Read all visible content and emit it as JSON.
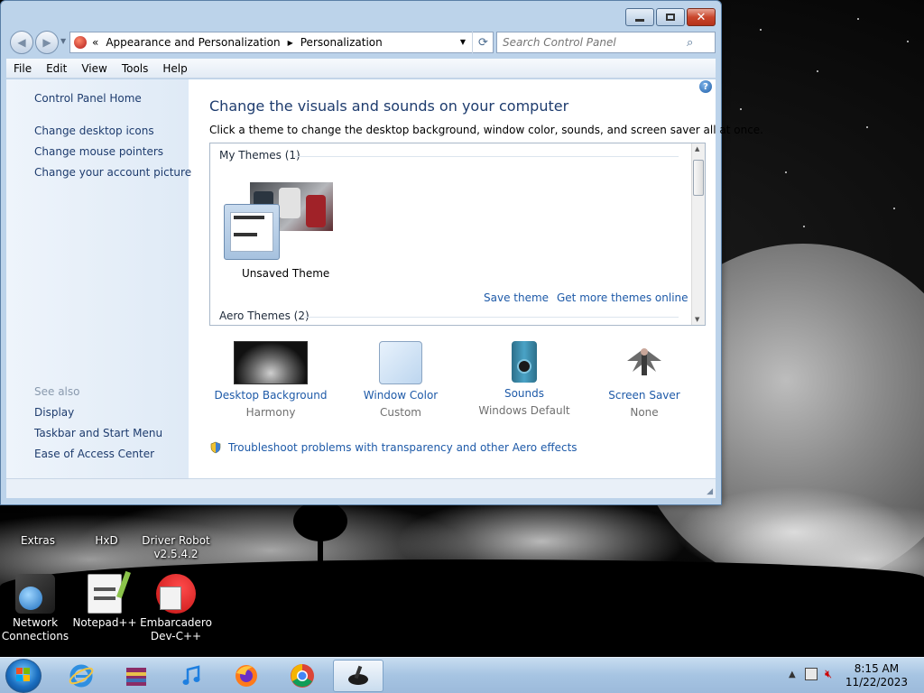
{
  "window": {
    "address": {
      "crumbs": [
        "Appearance and Personalization",
        "Personalization"
      ],
      "overflow_glyph": "«"
    },
    "search_placeholder": "Search Control Panel",
    "menu": [
      "File",
      "Edit",
      "View",
      "Tools",
      "Help"
    ],
    "left_pane": {
      "links": [
        "Control Panel Home",
        "Change desktop icons",
        "Change mouse pointers",
        "Change your account picture"
      ],
      "see_also_title": "See also",
      "see_also": [
        "Display",
        "Taskbar and Start Menu",
        "Ease of Access Center"
      ]
    },
    "main": {
      "title": "Change the visuals and sounds on your computer",
      "description": "Click a theme to change the desktop background, window color, sounds, and screen saver all at once.",
      "groups": [
        {
          "header": "My Themes (1)"
        },
        {
          "header": "Aero Themes (2)"
        }
      ],
      "theme_name": "Unsaved Theme",
      "save_theme": "Save theme",
      "get_more": "Get more themes online",
      "tiles": [
        {
          "label": "Desktop Background",
          "sub": "Harmony",
          "icon": "desktop-background-icon"
        },
        {
          "label": "Window Color",
          "sub": "Custom",
          "icon": "window-color-icon"
        },
        {
          "label": "Sounds",
          "sub": "Windows Default",
          "icon": "sounds-icon"
        },
        {
          "label": "Screen Saver",
          "sub": "None",
          "icon": "screen-saver-icon"
        }
      ],
      "troubleshoot": "Troubleshoot problems with transparency and other Aero effects"
    }
  },
  "desktop": {
    "icons": [
      {
        "label": "Extras"
      },
      {
        "label": "HxD"
      },
      {
        "label": "Driver Robot v2.5.4.2"
      },
      {
        "label": "Network Connections"
      },
      {
        "label": "Notepad++"
      },
      {
        "label": "Embarcadero Dev-C++"
      }
    ]
  },
  "taskbar": {
    "apps": [
      "internet-explorer-icon",
      "winrar-icon",
      "itunes-icon",
      "firefox-icon",
      "chrome-icon",
      "personalization-icon"
    ],
    "clock_time": "8:15 AM",
    "clock_date": "11/22/2023"
  },
  "colors": {
    "link": "#1e5aa8",
    "title": "#1e3c6e",
    "close_button": "#c9462c"
  }
}
